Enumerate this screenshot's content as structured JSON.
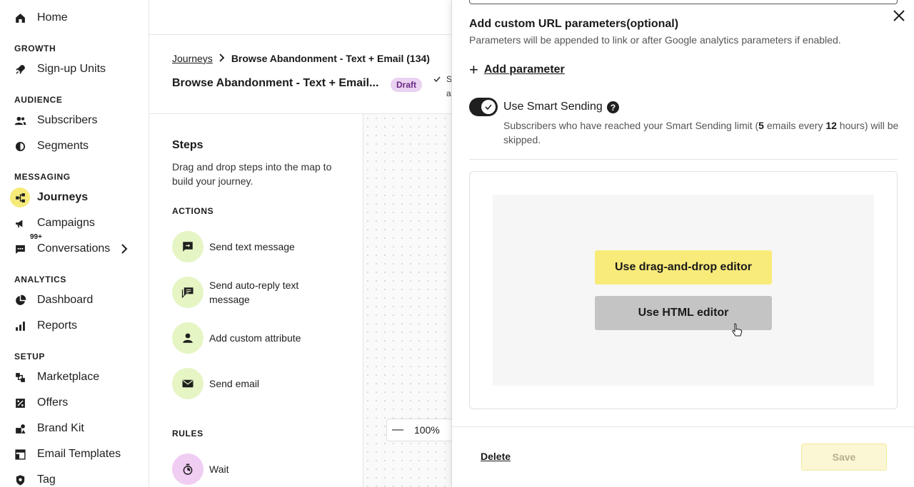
{
  "sidebar": {
    "home": "Home",
    "sections": {
      "growth": "GROWTH",
      "audience": "AUDIENCE",
      "messaging": "MESSAGING",
      "analytics": "ANALYTICS",
      "setup": "SETUP"
    },
    "items": {
      "signup_units": "Sign-up Units",
      "subscribers": "Subscribers",
      "segments": "Segments",
      "journeys": "Journeys",
      "campaigns": "Campaigns",
      "conversations": "Conversations",
      "conversations_badge": "99+",
      "dashboard": "Dashboard",
      "reports": "Reports",
      "marketplace": "Marketplace",
      "offers": "Offers",
      "brand_kit": "Brand Kit",
      "email_templates": "Email Templates",
      "tag": "Tag"
    },
    "icons": [
      "home-icon",
      "rocket-icon",
      "people-icon",
      "segment-icon",
      "journeys-icon",
      "megaphone-icon",
      "chat-icon",
      "pie-chart-icon",
      "bar-chart-icon",
      "marketplace-icon",
      "percent-icon",
      "brand-kit-icon",
      "template-icon",
      "tag-icon",
      "chevron-right-icon"
    ]
  },
  "header": {
    "breadcrumb_link": "Journeys",
    "breadcrumb_current": "Browse Abandonment - Text + Email (134)",
    "title": "Browse Abandonment - Text + Email...",
    "status": "Draft",
    "saved_line1": "S",
    "saved_line2": "a"
  },
  "steps": {
    "title": "Steps",
    "description": "Drag and drop steps into the map to build your journey.",
    "actions_heading": "ACTIONS",
    "actions": [
      "Send text message",
      "Send auto-reply text message",
      "Add custom attribute",
      "Send email"
    ],
    "rules_heading": "RULES",
    "rules": [
      "Wait"
    ]
  },
  "canvas": {
    "zoom": "100%",
    "zoom_minus": "—"
  },
  "drawer": {
    "url_params_heading": "Add custom URL parameters(optional)",
    "url_params_sub": "Parameters will be appended to link or after Google analytics parameters if enabled.",
    "add_parameter": "Add parameter",
    "add_symbol": "+",
    "smart_sending_label": "Use Smart Sending",
    "help_symbol": "?",
    "smart_sending_toggle_on": true,
    "smart_desc_pre": "Subscribers who have reached your Smart Sending limit (",
    "smart_desc_count": "5",
    "smart_desc_mid": " emails every ",
    "smart_desc_hours": "12",
    "smart_desc_post": " hours) will be skipped.",
    "drag_drop_button": "Use drag-and-drop editor",
    "html_button": "Use HTML editor",
    "delete": "Delete",
    "save": "Save"
  },
  "colors": {
    "accent_yellow": "#f9eb7a",
    "active_nav": "#f6eb7a",
    "action_circle": "#e5f5c4",
    "rule_circle": "#f0cdf2",
    "draft_badge": "#ead2f2",
    "html_button_gray": "#c4c4c4"
  }
}
